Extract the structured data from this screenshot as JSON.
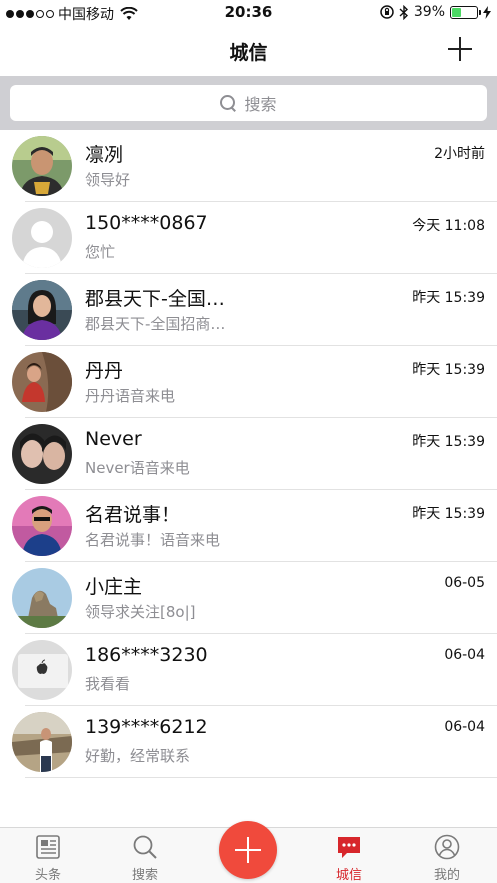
{
  "status_bar": {
    "carrier": "中国移动",
    "time": "20:36",
    "battery": "39%",
    "battery_level": 0.39,
    "icons": [
      "signal-dots-icon",
      "wifi-icon",
      "orientation-lock-icon",
      "bluetooth-icon",
      "battery-icon",
      "charging-icon"
    ]
  },
  "nav": {
    "title": "城信",
    "add_icon": "plus-icon"
  },
  "search": {
    "placeholder": "搜索"
  },
  "chats": [
    {
      "name": "凛冽",
      "time": "2小时前",
      "preview": "领导好"
    },
    {
      "name": "150****0867",
      "time": "今天 11:08",
      "preview": "您忙"
    },
    {
      "name": "郡县天下-全国…",
      "time": "昨天 15:39",
      "preview": "郡县天下-全国招商…"
    },
    {
      "name": "丹丹",
      "time": "昨天 15:39",
      "preview": "丹丹语音来电"
    },
    {
      "name": "Never",
      "time": "昨天 15:39",
      "preview": "Never语音来电"
    },
    {
      "name": "名君说事！",
      "time": "昨天 15:39",
      "preview": "名君说事！语音来电"
    },
    {
      "name": "小庄主",
      "time": "06-05",
      "preview": "领导求关注[8o|]"
    },
    {
      "name": "186****3230",
      "time": "06-04",
      "preview": "我看看"
    },
    {
      "name": "139****6212",
      "time": "06-04",
      "preview": "好勤，经常联系"
    }
  ],
  "tabs": [
    {
      "label": "头条",
      "icon": "news-icon"
    },
    {
      "label": "搜索",
      "icon": "search-icon"
    },
    {
      "label": "",
      "icon": "plus-icon"
    },
    {
      "label": "城信",
      "icon": "chat-icon",
      "active": true
    },
    {
      "label": "我的",
      "icon": "profile-icon"
    }
  ],
  "colors": {
    "accent": "#d7262b",
    "fab": "#f04a3c",
    "search_bg": "#cfcfd3"
  }
}
